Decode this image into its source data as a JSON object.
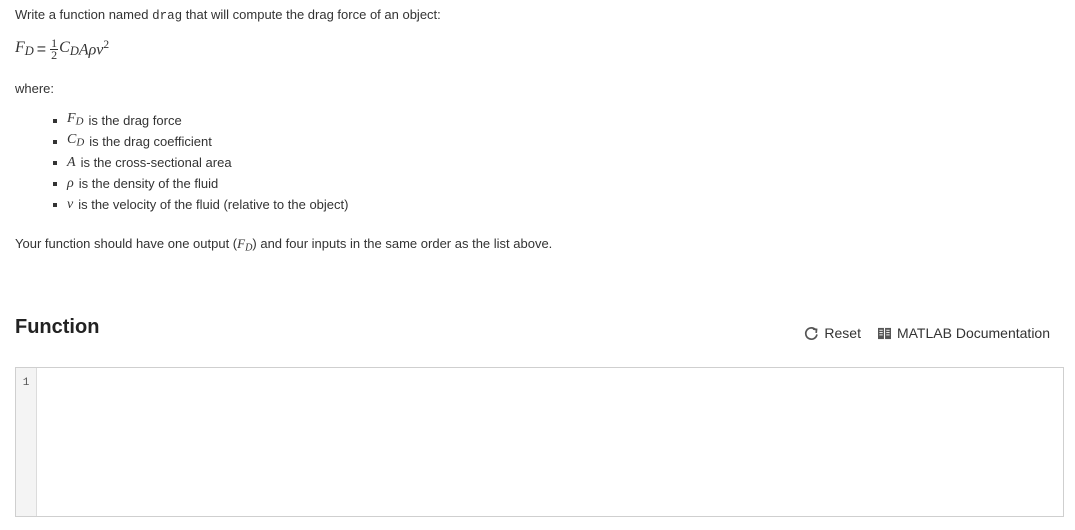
{
  "intro": {
    "before": "Write a function named ",
    "function_name": "drag",
    "after": " that will compute the drag force of an object:"
  },
  "equation": {
    "lhs": "F",
    "lhs_sub": "D",
    "equals": "=",
    "frac_num": "1",
    "frac_den": "2",
    "c": "C",
    "c_sub": "D",
    "rest": "Aρv",
    "rest_sup": "2"
  },
  "where_label": "where:",
  "definitions": [
    {
      "symbol": "F",
      "sub": "D",
      "text": "is the drag force"
    },
    {
      "symbol": "C",
      "sub": "D",
      "text": "is the drag coefficient"
    },
    {
      "symbol": "A",
      "sub": "",
      "text": "is the cross-sectional area"
    },
    {
      "symbol": "ρ",
      "sub": "",
      "text": "is the density of the fluid"
    },
    {
      "symbol": "v",
      "sub": "",
      "text": "is the velocity of the fluid (relative to the object)"
    }
  ],
  "output_line": {
    "before": "Your function should have one output (",
    "symbol": "F",
    "sub": "D",
    "after": ") and four inputs in the same order as the list above."
  },
  "section": {
    "title": "Function",
    "reset_label": "Reset",
    "reset_icon": "reset-icon",
    "doc_label": "MATLAB Documentation",
    "doc_icon": "book-icon"
  },
  "editor": {
    "line_numbers": [
      "1"
    ],
    "code": ""
  }
}
